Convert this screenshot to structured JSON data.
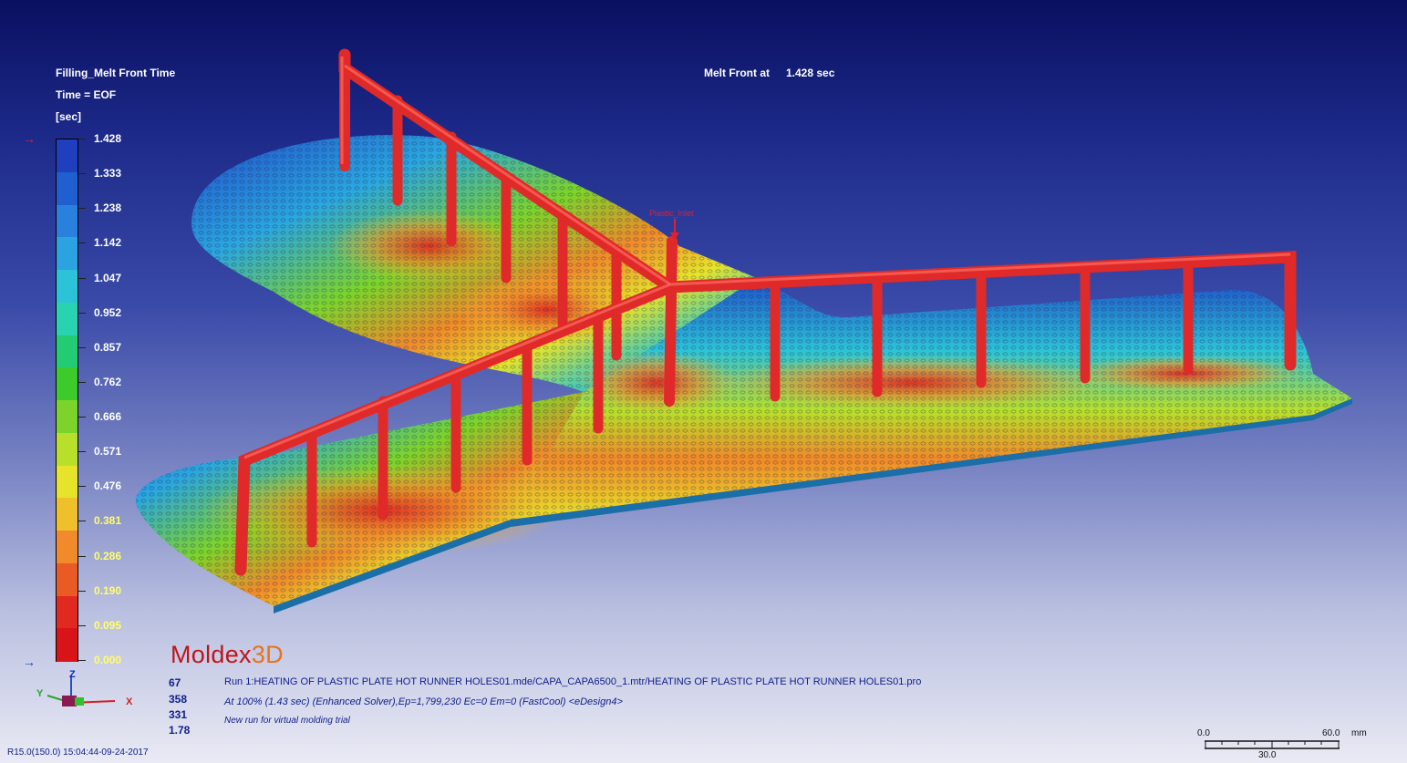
{
  "legend": {
    "title": "Filling_Melt Front Time",
    "time_label": "Time = EOF",
    "unit": "[sec]",
    "ticks": [
      "1.428",
      "1.333",
      "1.238",
      "1.142",
      "1.047",
      "0.952",
      "0.857",
      "0.762",
      "0.666",
      "0.571",
      "0.476",
      "0.381",
      "0.286",
      "0.190",
      "0.095",
      "0.000"
    ]
  },
  "header": {
    "melt_front_label": "Melt Front at",
    "melt_front_value": "1.428 sec"
  },
  "scene": {
    "gate_label": "Plastic_Inlet"
  },
  "logo": {
    "brand": "Moldex",
    "suffix": "3D"
  },
  "stats": [
    "67",
    "358",
    "331",
    "1.78"
  ],
  "run_info": {
    "line1": "Run 1:HEATING OF PLASTIC PLATE HOT RUNNER HOLES01.mde/CAPA_CAPA6500_1.mtr/HEATING OF PLASTIC PLATE HOT RUNNER HOLES01.pro",
    "line2": "At 100% (1.43 sec) (Enhanced Solver),Ep=1,799,230 Ec=0 Em=0 (FastCool) <eDesign4>",
    "line3": "New run for virtual molding trial"
  },
  "axis": {
    "x": "X",
    "y": "Y",
    "z": "Z"
  },
  "version": "R15.0(150.0) 15:04:44-09-24-2017",
  "scale": {
    "left": "0.0",
    "right": "60.0",
    "unit": "mm",
    "mid": "30.0"
  },
  "colors": {
    "colorbar": [
      "#1f3fbf",
      "#1f5fd0",
      "#2a80dd",
      "#2aa3e0",
      "#2cc3d8",
      "#28d3b0",
      "#22cc72",
      "#3ccb2a",
      "#7cd42a",
      "#b8e02a",
      "#e6e42a",
      "#f0c02a",
      "#f08a2a",
      "#ea5a24",
      "#e02a20",
      "#d81418"
    ],
    "runner": "#e02a2a",
    "arrow": "#e02030"
  }
}
